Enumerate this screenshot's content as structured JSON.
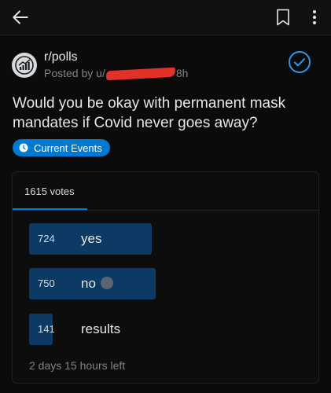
{
  "icons": {
    "back": "back-arrow-icon",
    "bookmark": "bookmark-icon",
    "more": "more-vertical-icon",
    "community": "trending-chart-icon",
    "joined": "check-circle-icon",
    "flair": "clock-icon",
    "chosen": "check-badge-icon"
  },
  "post": {
    "subreddit": "r/polls",
    "posted_by_prefix": "Posted by u/",
    "age": "8h",
    "title": "Would you be okay with permanent mask mandates if Covid never goes away?",
    "flair": "Current Events"
  },
  "poll": {
    "total_votes": "1615 votes",
    "options": [
      {
        "count": "724",
        "label": "yes",
        "fraction": 0.4483
      },
      {
        "count": "750",
        "label": "no",
        "fraction": 0.4644,
        "selected": true
      },
      {
        "count": "141",
        "label": "results",
        "fraction": 0.0873
      }
    ],
    "time_left": "2 days 15 hours left"
  },
  "colors": {
    "accent": "#0079d3",
    "bar": "#0d3a64",
    "redaction": "#e0312a",
    "background": "#0b0b0b"
  }
}
